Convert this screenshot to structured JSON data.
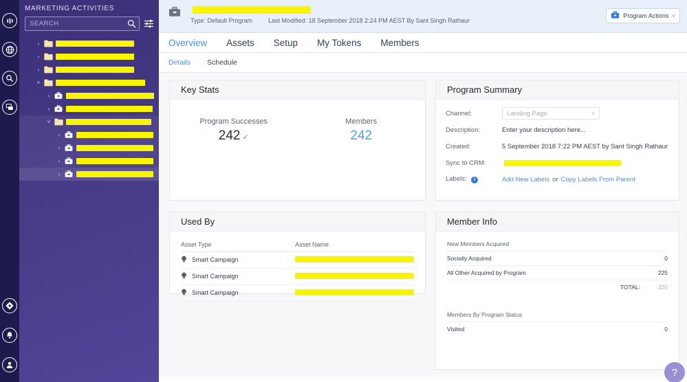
{
  "rail": {
    "top_icons": [
      {
        "name": "analytics-icon"
      },
      {
        "name": "globe-icon"
      },
      {
        "name": "search-icon"
      },
      {
        "name": "chat-icon"
      }
    ],
    "bottom_icons": [
      {
        "name": "gear-icon"
      },
      {
        "name": "bell-icon"
      },
      {
        "name": "user-icon"
      }
    ]
  },
  "sidebar": {
    "title": "MARKETING ACTIVITIES",
    "search": {
      "value": "",
      "placeholder": "SEARCH"
    },
    "filter_icon": "filter-sliders-icon",
    "collapse_label": "‹",
    "tree": [
      {
        "type": "folder",
        "depth": 0,
        "expanded": false,
        "caret": "›",
        "redacted": true,
        "width": 114,
        "state": "normal"
      },
      {
        "type": "folder",
        "depth": 0,
        "expanded": false,
        "caret": "›",
        "redacted": true,
        "width": 114,
        "state": "normal"
      },
      {
        "type": "folder",
        "depth": 0,
        "expanded": false,
        "caret": "›",
        "redacted": true,
        "width": 114,
        "state": "normal"
      },
      {
        "type": "folder",
        "depth": 0,
        "expanded": true,
        "caret": "˅",
        "redacted": true,
        "width": 130,
        "state": "normal"
      },
      {
        "type": "program",
        "depth": 1,
        "expanded": false,
        "caret": "›",
        "redacted": true,
        "width": 128,
        "state": "normal"
      },
      {
        "type": "program",
        "depth": 1,
        "expanded": false,
        "caret": "›",
        "redacted": true,
        "width": 126,
        "state": "normal"
      },
      {
        "type": "folder",
        "depth": 1,
        "expanded": true,
        "caret": "˅",
        "redacted": true,
        "width": 124,
        "state": "expanded-bg"
      },
      {
        "type": "program",
        "depth": 2,
        "expanded": false,
        "caret": "›",
        "redacted": true,
        "width": 112,
        "state": "expanded-bg"
      },
      {
        "type": "program",
        "depth": 2,
        "expanded": false,
        "caret": "›",
        "redacted": true,
        "width": 112,
        "state": "expanded-bg"
      },
      {
        "type": "program",
        "depth": 2,
        "expanded": false,
        "caret": "›",
        "redacted": true,
        "width": 112,
        "state": "expanded-bg"
      },
      {
        "type": "program",
        "depth": 2,
        "expanded": false,
        "caret": "›",
        "redacted": true,
        "width": 112,
        "state": "selected"
      }
    ]
  },
  "program_header": {
    "icon": "briefcase-icon",
    "title_redacted": true,
    "title_width": 172,
    "type_label": "Type: Default Program",
    "last_modified": "Last Modified: 18 September 2018 2:24 PM AEST By Sant Singh Rathaur",
    "actions_button": {
      "icon": "briefcase-icon",
      "label": "Program Actions",
      "chevron": "˅"
    }
  },
  "tabs": [
    {
      "label": "Overview",
      "active": true
    },
    {
      "label": "Assets",
      "active": false
    },
    {
      "label": "Setup",
      "active": false
    },
    {
      "label": "My Tokens",
      "active": false
    },
    {
      "label": "Members",
      "active": false
    }
  ],
  "subtabs": [
    {
      "label": "Details",
      "active": true
    },
    {
      "label": "Schedule",
      "active": false
    }
  ],
  "key_stats": {
    "title": "Key Stats",
    "items": [
      {
        "label": "Program Successes",
        "value": "242",
        "check": "✓",
        "is_link": false
      },
      {
        "label": "Members",
        "value": "242",
        "check": "",
        "is_link": true
      }
    ]
  },
  "program_summary": {
    "title": "Program Summary",
    "channel_label": "Channel:",
    "channel_value": "Landing Page",
    "channel_chevron": "˅",
    "description_label": "Description:",
    "description_value": "Enter your description here...",
    "created_label": "Created:",
    "created_value": "5 September 2018 7:22 PM AEST by Sant Singh Rathaur",
    "sync_label": "Sync to CRM:",
    "sync_redacted": true,
    "sync_width": 170,
    "labels_label": "Labels:",
    "info_icon": "info-icon",
    "add_labels_link": "Add New Labels",
    "or_text": "or",
    "copy_labels_link": "Copy Labels From Parent"
  },
  "used_by": {
    "title": "Used By",
    "columns": [
      "Asset Type",
      "Asset Name"
    ],
    "rows": [
      {
        "icon": "lightbulb-icon",
        "asset_type": "Smart Campaign",
        "asset_name_redacted": true,
        "name_width": 173
      },
      {
        "icon": "lightbulb-icon",
        "asset_type": "Smart Campaign",
        "asset_name_redacted": true,
        "name_width": 173
      },
      {
        "icon": "lightbulb-icon",
        "asset_type": "Smart Campaign",
        "asset_name_redacted": true,
        "name_width": 173
      }
    ]
  },
  "member_info": {
    "title": "Member Info",
    "section_1": "New Members Acquired",
    "rows_1": [
      {
        "name": "Socially Acquired",
        "value": "0"
      },
      {
        "name": "All Other Acquired by Program",
        "value": "225"
      }
    ],
    "total_label": "TOTAL:",
    "total_value": "225",
    "section_2": "Members By Program Status",
    "rows_2": [
      {
        "name": "Visited",
        "value": "0"
      }
    ]
  },
  "help": {
    "label": "?"
  },
  "colors": {
    "rail_bg": "#1d1a4e",
    "sidebar_bg": "#473b87",
    "redaction": "#f9f400",
    "header_bg": "#e9f0f9",
    "accent_link": "#4a90d9",
    "success_green": "#5aa04a",
    "help_purple": "#9a8fd0"
  }
}
